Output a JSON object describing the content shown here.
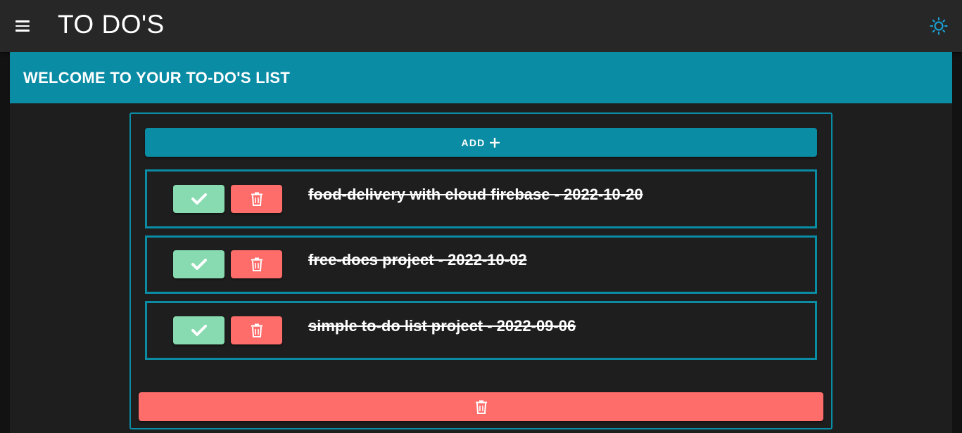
{
  "appbar": {
    "title": "TO DO'S",
    "menu_icon": "menu-icon",
    "theme_icon": "sun-icon",
    "theme_icon_color": "#1a9fcf"
  },
  "banner": {
    "text": "WELCOME TO YOUR TO-DO'S LIST",
    "color": "#0a8ca5"
  },
  "add_button": {
    "label": "ADD",
    "icon": "plus-icon"
  },
  "todos": [
    {
      "text": "food-delivery with cloud firebase - 2022-10-20",
      "completed": true
    },
    {
      "text": "free-docs project - 2022-10-02",
      "completed": true
    },
    {
      "text": "simple to-do list project - 2022-09-06",
      "completed": true
    }
  ],
  "item_buttons": {
    "complete_icon": "check-icon",
    "delete_icon": "trash-icon",
    "complete_color": "#88dbb0",
    "delete_color": "#ff6d6a"
  },
  "clear_button": {
    "icon": "trash-icon"
  }
}
